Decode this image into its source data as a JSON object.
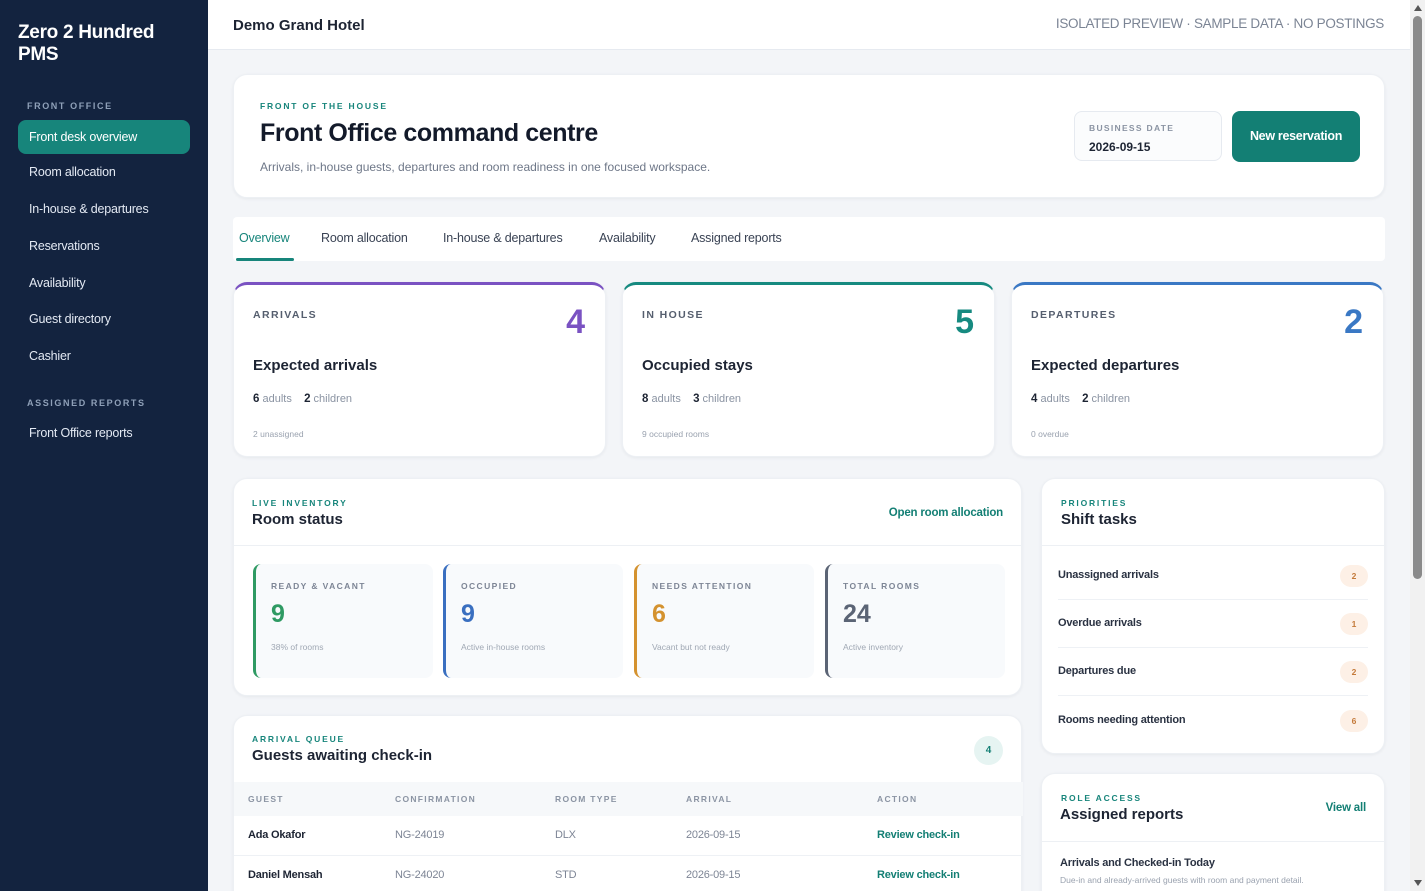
{
  "sidebar": {
    "brand": "Zero 2 Hundred PMS",
    "sections": [
      {
        "label": "FRONT OFFICE"
      },
      {
        "label": "ASSIGNED REPORTS"
      }
    ],
    "items": [
      {
        "label": "Front desk overview"
      },
      {
        "label": "Room allocation"
      },
      {
        "label": "In-house & departures"
      },
      {
        "label": "Reservations"
      },
      {
        "label": "Availability"
      },
      {
        "label": "Guest directory"
      },
      {
        "label": "Cashier"
      },
      {
        "label": "Front Office reports"
      }
    ]
  },
  "topbar": {
    "hotel": "Demo Grand Hotel",
    "tag": "ISOLATED PREVIEW · SAMPLE DATA · NO POSTINGS"
  },
  "hero": {
    "eyebrow": "FRONT OF THE HOUSE",
    "title": "Front Office command centre",
    "subtitle": "Arrivals, in-house guests, departures and room readiness in one focused workspace.",
    "business_date_label": "BUSINESS DATE",
    "business_date": "2026-09-15",
    "new_reservation": "New reservation"
  },
  "tabs": [
    {
      "label": "Overview"
    },
    {
      "label": "Room allocation"
    },
    {
      "label": "In-house & departures"
    },
    {
      "label": "Availability"
    },
    {
      "label": "Assigned reports"
    }
  ],
  "stats": [
    {
      "label": "ARRIVALS",
      "count": "4",
      "title": "Expected arrivals",
      "adults": "6",
      "adults_label": "adults",
      "children": "2",
      "children_label": "children",
      "foot": "2 unassigned",
      "color": "#7a52c2"
    },
    {
      "label": "IN HOUSE",
      "count": "5",
      "title": "Occupied stays",
      "adults": "8",
      "adults_label": "adults",
      "children": "3",
      "children_label": "children",
      "foot": "9 occupied rooms",
      "color": "#168a80"
    },
    {
      "label": "DEPARTURES",
      "count": "2",
      "title": "Expected departures",
      "adults": "4",
      "adults_label": "adults",
      "children": "2",
      "children_label": "children",
      "foot": "0 overdue",
      "color": "#3a78c4"
    }
  ],
  "room_status": {
    "eyebrow": "LIVE INVENTORY",
    "title": "Room status",
    "link": "Open room allocation",
    "items": [
      {
        "label": "READY & VACANT",
        "value": "9",
        "sub": "38% of rooms",
        "color": "#2f9a63"
      },
      {
        "label": "OCCUPIED",
        "value": "9",
        "sub": "Active in-house rooms",
        "color": "#3a6fc0"
      },
      {
        "label": "NEEDS ATTENTION",
        "value": "6",
        "sub": "Vacant but not ready",
        "color": "#d4922f"
      },
      {
        "label": "TOTAL ROOMS",
        "value": "24",
        "sub": "Active inventory",
        "color": "#5b6475"
      }
    ]
  },
  "shift_tasks": {
    "eyebrow": "PRIORITIES",
    "title": "Shift tasks",
    "items": [
      {
        "label": "Unassigned arrivals",
        "count": "2"
      },
      {
        "label": "Overdue arrivals",
        "count": "1"
      },
      {
        "label": "Departures due",
        "count": "2"
      },
      {
        "label": "Rooms needing attention",
        "count": "6"
      }
    ]
  },
  "arrival_queue": {
    "eyebrow": "ARRIVAL QUEUE",
    "title": "Guests awaiting check-in",
    "count": "4",
    "columns": [
      "GUEST",
      "CONFIRMATION",
      "ROOM TYPE",
      "ARRIVAL",
      "ACTION"
    ],
    "rows": [
      {
        "guest": "Ada Okafor",
        "confirmation": "NG-24019",
        "room_type": "DLX",
        "arrival": "2026-09-15",
        "action": "Review check-in"
      },
      {
        "guest": "Daniel Mensah",
        "confirmation": "NG-24020",
        "room_type": "STD",
        "arrival": "2026-09-15",
        "action": "Review check-in"
      }
    ]
  },
  "assigned_reports": {
    "eyebrow": "ROLE ACCESS",
    "title": "Assigned reports",
    "link": "View all",
    "report_title": "Arrivals and Checked-in Today",
    "report_desc": "Due-in and already-arrived guests with room and payment detail."
  }
}
